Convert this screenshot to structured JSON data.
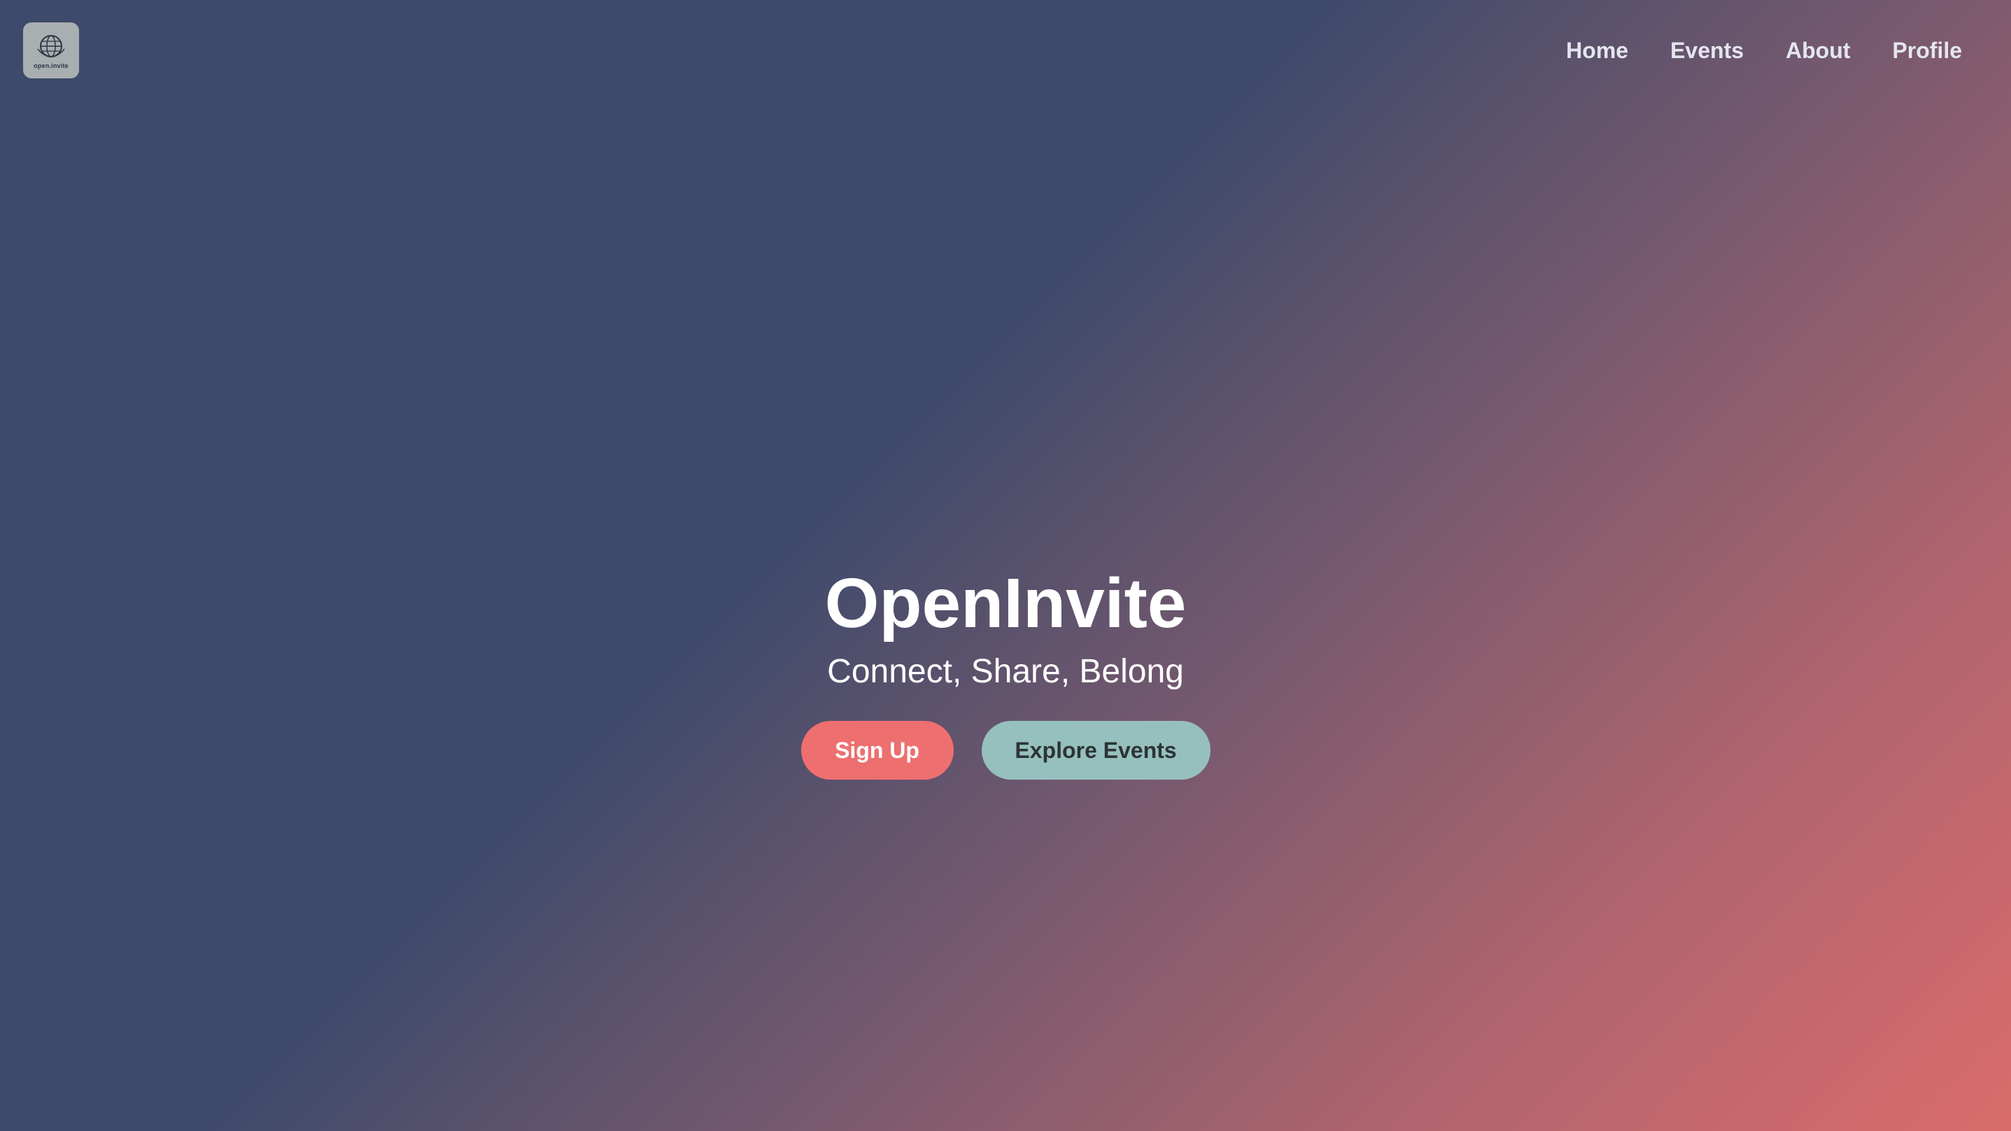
{
  "brand": {
    "logo_text": "open.invite",
    "icon": "globe-icon"
  },
  "nav": {
    "items": [
      {
        "label": "Home"
      },
      {
        "label": "Events"
      },
      {
        "label": "About"
      },
      {
        "label": "Profile"
      }
    ]
  },
  "hero": {
    "title": "OpenInvite",
    "subtitle": "Connect, Share, Belong",
    "primary_button": "Sign Up",
    "secondary_button": "Explore Events"
  },
  "colors": {
    "gradient_start": "#3d4a6b",
    "gradient_end": "#d96c6c",
    "primary_button": "#ee6f6f",
    "secondary_button": "#96c0bd"
  }
}
